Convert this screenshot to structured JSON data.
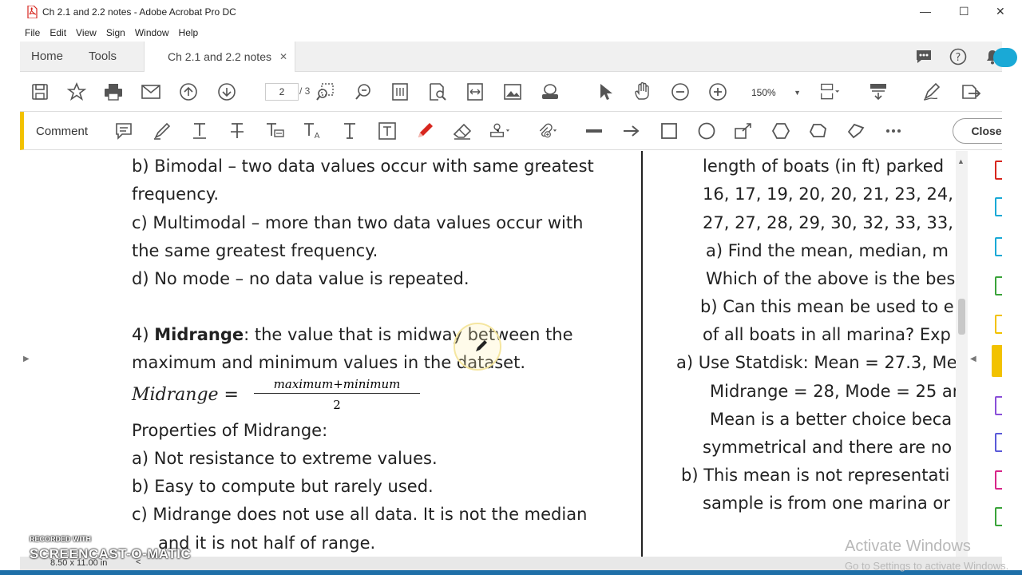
{
  "window": {
    "title": "Ch 2.1 and 2.2 notes - Adobe Acrobat Pro DC",
    "minimize": "—",
    "maximize": "☐",
    "close": "✕"
  },
  "menu": [
    "File",
    "Edit",
    "View",
    "Sign",
    "Window",
    "Help"
  ],
  "tabs": {
    "home": "Home",
    "tools": "Tools",
    "doc": "Ch 2.1 and 2.2 notes",
    "doc_close": "✕"
  },
  "toolbar": {
    "page_current": "2",
    "page_total": "/  3",
    "zoom": "150%"
  },
  "comment_bar": {
    "label": "Comment",
    "close": "Close"
  },
  "left_page": {
    "line1": "b) Bimodal – two data values occur with same greatest",
    "line2": "frequency.",
    "line3": "c) Multimodal – more than two data values occur with",
    "line4": "the same greatest frequency.",
    "line5": "d) No mode – no data value is repeated.",
    "midrange_num": "4) ",
    "midrange_term": "Midrange",
    "midrange_def": ": the value that is midway between the",
    "line7": "maximum and minimum values in the dataset.",
    "formula_lhs": "Midrange =",
    "formula_num": "maximum+minimum",
    "formula_den": "2",
    "props_title": "Properties of Midrange:",
    "prop_a": "a) Not resistance to extreme values.",
    "prop_b": "b) Easy to compute but rarely used.",
    "prop_c1": "c) Midrange does not use all data. It is not the median",
    "prop_c2": "and it is not half of range."
  },
  "right_page": {
    "l1": "length of boats (in ft) parked",
    "l2": "16, 17, 19, 20, 20, 21, 23, 24,",
    "l3": "27, 27, 28, 29, 30, 32, 33, 33,",
    "l4": "a) Find the mean, median, m",
    "l5": "Which of the above is the bes",
    "l6": "b) Can this mean be used to e",
    "l7": "of all boats in all marina? Exp",
    "l8": "a) Use Statdisk: Mean = 27.3, Me",
    "l9": "Midrange = 28, Mode = 25 ar",
    "l10": "Mean is a better choice beca",
    "l11": "symmetrical and there are no",
    "l12": "b) This mean is not representati",
    "l13": "sample is from one marina or"
  },
  "status": {
    "page_size": "8.50 x 11.00 in"
  },
  "watermark": {
    "activate": "Activate Windows",
    "goto": "Go to Settings to activate Windows.",
    "recorded": "RECORDED WITH",
    "screencast": "SCREENCAST-O-MATIC"
  },
  "colors": {
    "accent_yellow": "#f2c200",
    "pdf_red": "#d7261e",
    "teal": "#1aa9d6"
  }
}
